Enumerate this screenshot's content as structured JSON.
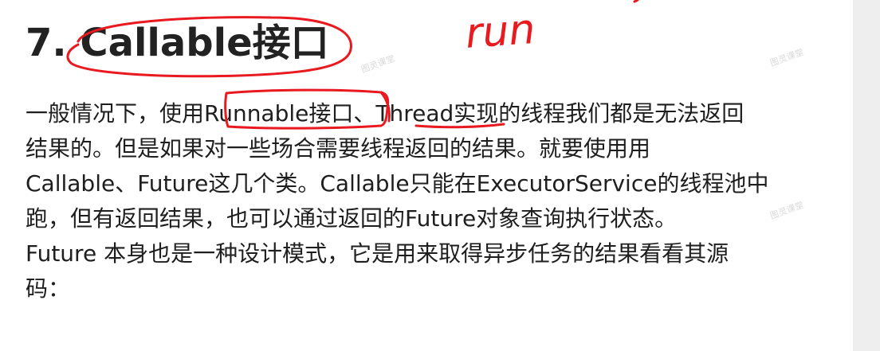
{
  "heading": "7. Callable接口",
  "handwriting": "run",
  "paragraph": [
    "一般情况下，使用Runnable接口、Thread实现的线程我们都是无法返回",
    "结果的。但是如果对一些场合需要线程返回的结果。就要使用用",
    "Callable、Future这几个类。Callable只能在ExecutorService的线程池中",
    "跑，但有返回结果，也可以通过返回的Future对象查询执行状态。",
    "Future 本身也是一种设计模式，它是用来取得异步任务的结果看看其源",
    "码："
  ],
  "watermark": "图灵课堂",
  "ink_color": "#e8191f"
}
